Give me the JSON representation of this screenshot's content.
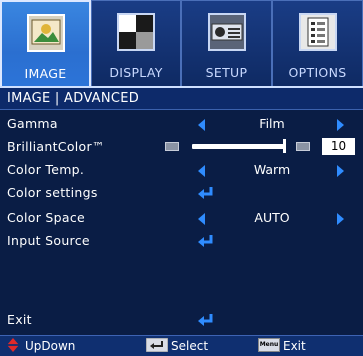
{
  "tabs": [
    {
      "label": "IMAGE",
      "icon": "image-icon",
      "active": true
    },
    {
      "label": "DISPLAY",
      "icon": "display-icon",
      "active": false
    },
    {
      "label": "SETUP",
      "icon": "setup-icon",
      "active": false
    },
    {
      "label": "OPTIONS",
      "icon": "options-icon",
      "active": false
    }
  ],
  "header": {
    "title": "IMAGE | ADVANCED"
  },
  "rows": {
    "gamma": {
      "label": "Gamma",
      "value": "Film"
    },
    "brilliant_color": {
      "label": "BrilliantColor™",
      "value": "10",
      "level": 1.0
    },
    "color_temp": {
      "label": "Color Temp.",
      "value": "Warm"
    },
    "color_settings": {
      "label": "Color settings"
    },
    "color_space": {
      "label": "Color Space",
      "value": "AUTO"
    },
    "input_source": {
      "label": "Input Source"
    },
    "exit": {
      "label": "Exit"
    }
  },
  "footer": {
    "updown_label": "UpDown",
    "select_label": "Select",
    "exit_label": "Exit",
    "menu_key_label": "Menu"
  },
  "colors": {
    "accent": "#2f8cff",
    "background": "#0a1d45",
    "active_tab": "#2b6fd0"
  }
}
